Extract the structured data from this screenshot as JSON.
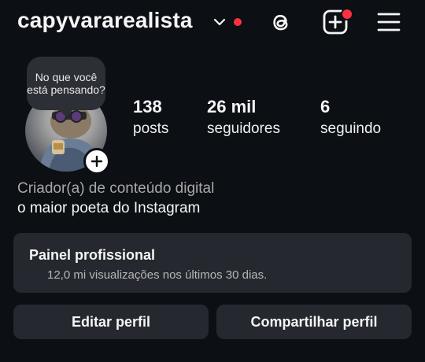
{
  "header": {
    "username": "capyvararealista",
    "icons": [
      "chevron-down-icon",
      "threads-icon",
      "new-post-icon",
      "menu-icon"
    ],
    "notification_color": "#ff3040"
  },
  "profile": {
    "thought_bubble": "No que você está pensando?",
    "stats": [
      {
        "value": "138",
        "label": "posts"
      },
      {
        "value": "26 mil",
        "label": "seguidores"
      },
      {
        "value": "6",
        "label": "seguindo"
      }
    ]
  },
  "bio": {
    "category": "Criador(a) de conteúdo digital",
    "text": "o maior poeta do Instagram"
  },
  "professional_panel": {
    "title": "Painel profissional",
    "subtitle": "12,0 mi visualizações nos últimos 30 dias."
  },
  "actions": {
    "edit_label": "Editar perfil",
    "share_label": "Compartilhar perfil"
  }
}
